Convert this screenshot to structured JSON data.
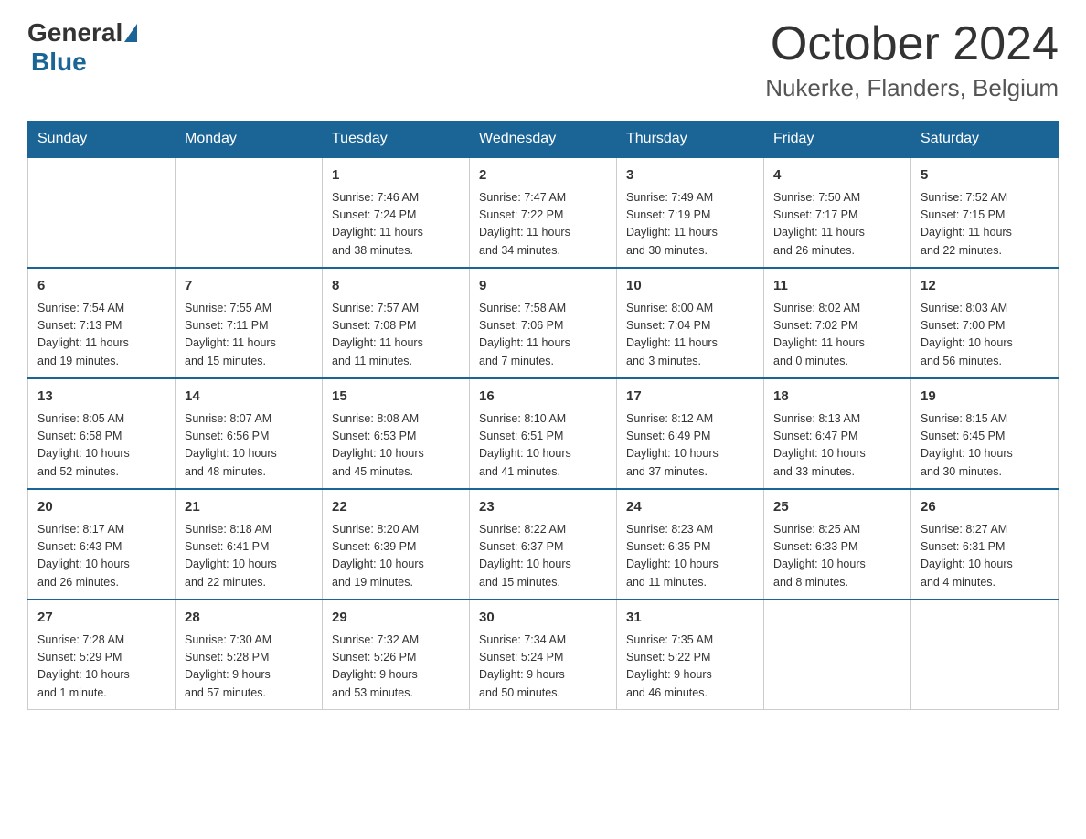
{
  "header": {
    "logo_general": "General",
    "logo_blue": "Blue",
    "month_title": "October 2024",
    "location": "Nukerke, Flanders, Belgium"
  },
  "weekdays": [
    "Sunday",
    "Monday",
    "Tuesday",
    "Wednesday",
    "Thursday",
    "Friday",
    "Saturday"
  ],
  "weeks": [
    [
      {
        "day": "",
        "info": ""
      },
      {
        "day": "",
        "info": ""
      },
      {
        "day": "1",
        "info": "Sunrise: 7:46 AM\nSunset: 7:24 PM\nDaylight: 11 hours\nand 38 minutes."
      },
      {
        "day": "2",
        "info": "Sunrise: 7:47 AM\nSunset: 7:22 PM\nDaylight: 11 hours\nand 34 minutes."
      },
      {
        "day": "3",
        "info": "Sunrise: 7:49 AM\nSunset: 7:19 PM\nDaylight: 11 hours\nand 30 minutes."
      },
      {
        "day": "4",
        "info": "Sunrise: 7:50 AM\nSunset: 7:17 PM\nDaylight: 11 hours\nand 26 minutes."
      },
      {
        "day": "5",
        "info": "Sunrise: 7:52 AM\nSunset: 7:15 PM\nDaylight: 11 hours\nand 22 minutes."
      }
    ],
    [
      {
        "day": "6",
        "info": "Sunrise: 7:54 AM\nSunset: 7:13 PM\nDaylight: 11 hours\nand 19 minutes."
      },
      {
        "day": "7",
        "info": "Sunrise: 7:55 AM\nSunset: 7:11 PM\nDaylight: 11 hours\nand 15 minutes."
      },
      {
        "day": "8",
        "info": "Sunrise: 7:57 AM\nSunset: 7:08 PM\nDaylight: 11 hours\nand 11 minutes."
      },
      {
        "day": "9",
        "info": "Sunrise: 7:58 AM\nSunset: 7:06 PM\nDaylight: 11 hours\nand 7 minutes."
      },
      {
        "day": "10",
        "info": "Sunrise: 8:00 AM\nSunset: 7:04 PM\nDaylight: 11 hours\nand 3 minutes."
      },
      {
        "day": "11",
        "info": "Sunrise: 8:02 AM\nSunset: 7:02 PM\nDaylight: 11 hours\nand 0 minutes."
      },
      {
        "day": "12",
        "info": "Sunrise: 8:03 AM\nSunset: 7:00 PM\nDaylight: 10 hours\nand 56 minutes."
      }
    ],
    [
      {
        "day": "13",
        "info": "Sunrise: 8:05 AM\nSunset: 6:58 PM\nDaylight: 10 hours\nand 52 minutes."
      },
      {
        "day": "14",
        "info": "Sunrise: 8:07 AM\nSunset: 6:56 PM\nDaylight: 10 hours\nand 48 minutes."
      },
      {
        "day": "15",
        "info": "Sunrise: 8:08 AM\nSunset: 6:53 PM\nDaylight: 10 hours\nand 45 minutes."
      },
      {
        "day": "16",
        "info": "Sunrise: 8:10 AM\nSunset: 6:51 PM\nDaylight: 10 hours\nand 41 minutes."
      },
      {
        "day": "17",
        "info": "Sunrise: 8:12 AM\nSunset: 6:49 PM\nDaylight: 10 hours\nand 37 minutes."
      },
      {
        "day": "18",
        "info": "Sunrise: 8:13 AM\nSunset: 6:47 PM\nDaylight: 10 hours\nand 33 minutes."
      },
      {
        "day": "19",
        "info": "Sunrise: 8:15 AM\nSunset: 6:45 PM\nDaylight: 10 hours\nand 30 minutes."
      }
    ],
    [
      {
        "day": "20",
        "info": "Sunrise: 8:17 AM\nSunset: 6:43 PM\nDaylight: 10 hours\nand 26 minutes."
      },
      {
        "day": "21",
        "info": "Sunrise: 8:18 AM\nSunset: 6:41 PM\nDaylight: 10 hours\nand 22 minutes."
      },
      {
        "day": "22",
        "info": "Sunrise: 8:20 AM\nSunset: 6:39 PM\nDaylight: 10 hours\nand 19 minutes."
      },
      {
        "day": "23",
        "info": "Sunrise: 8:22 AM\nSunset: 6:37 PM\nDaylight: 10 hours\nand 15 minutes."
      },
      {
        "day": "24",
        "info": "Sunrise: 8:23 AM\nSunset: 6:35 PM\nDaylight: 10 hours\nand 11 minutes."
      },
      {
        "day": "25",
        "info": "Sunrise: 8:25 AM\nSunset: 6:33 PM\nDaylight: 10 hours\nand 8 minutes."
      },
      {
        "day": "26",
        "info": "Sunrise: 8:27 AM\nSunset: 6:31 PM\nDaylight: 10 hours\nand 4 minutes."
      }
    ],
    [
      {
        "day": "27",
        "info": "Sunrise: 7:28 AM\nSunset: 5:29 PM\nDaylight: 10 hours\nand 1 minute."
      },
      {
        "day": "28",
        "info": "Sunrise: 7:30 AM\nSunset: 5:28 PM\nDaylight: 9 hours\nand 57 minutes."
      },
      {
        "day": "29",
        "info": "Sunrise: 7:32 AM\nSunset: 5:26 PM\nDaylight: 9 hours\nand 53 minutes."
      },
      {
        "day": "30",
        "info": "Sunrise: 7:34 AM\nSunset: 5:24 PM\nDaylight: 9 hours\nand 50 minutes."
      },
      {
        "day": "31",
        "info": "Sunrise: 7:35 AM\nSunset: 5:22 PM\nDaylight: 9 hours\nand 46 minutes."
      },
      {
        "day": "",
        "info": ""
      },
      {
        "day": "",
        "info": ""
      }
    ]
  ]
}
